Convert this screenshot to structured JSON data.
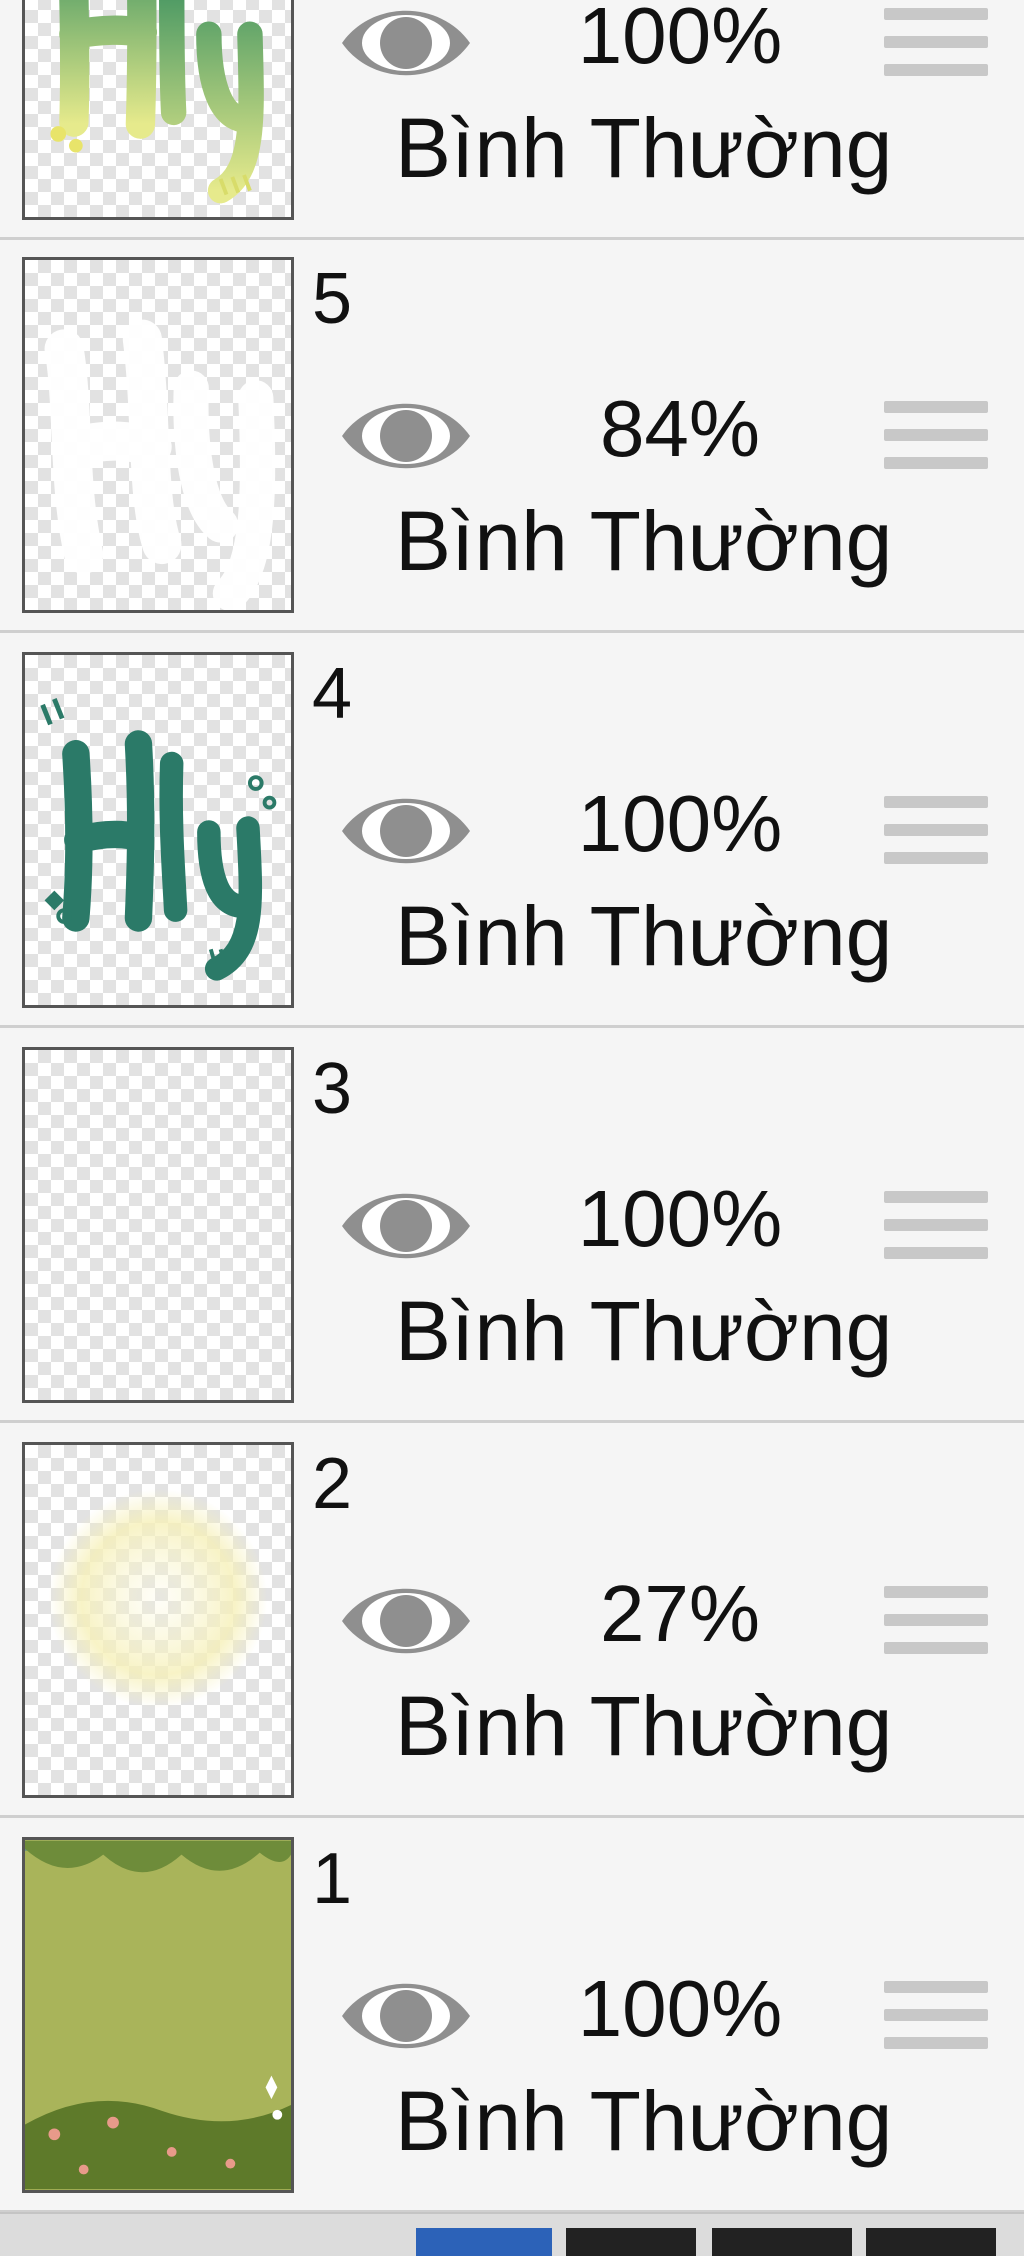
{
  "layers_panel": {
    "layers": [
      {
        "number": "",
        "opacity": "100%",
        "blend_mode": "Bình Thường",
        "thumbnail": "lettering-yellow-green"
      },
      {
        "number": "5",
        "opacity": "84%",
        "blend_mode": "Bình Thường",
        "thumbnail": "white-silhouette"
      },
      {
        "number": "4",
        "opacity": "100%",
        "blend_mode": "Bình Thường",
        "thumbnail": "lettering-teal"
      },
      {
        "number": "3",
        "opacity": "100%",
        "blend_mode": "Bình Thường",
        "thumbnail": "empty"
      },
      {
        "number": "2",
        "opacity": "27%",
        "blend_mode": "Bình Thường",
        "thumbnail": "pale-yellow-glow"
      },
      {
        "number": "1",
        "opacity": "100%",
        "blend_mode": "Bình Thường",
        "thumbnail": "olive-green-background"
      }
    ]
  },
  "icons": {
    "visibility": "eye-icon",
    "reorder": "drag-handle-icon"
  },
  "colors": {
    "panel_bg": "#f5f5f5",
    "divider": "#cfcfcf",
    "icon_gray": "#8f8f8f",
    "handle_gray": "#c8c8c8",
    "thumb_border": "#555555",
    "teal_lettering": "#2b7a68",
    "olive_background": "#a9b45a",
    "active_tab": "#2c62b8"
  }
}
